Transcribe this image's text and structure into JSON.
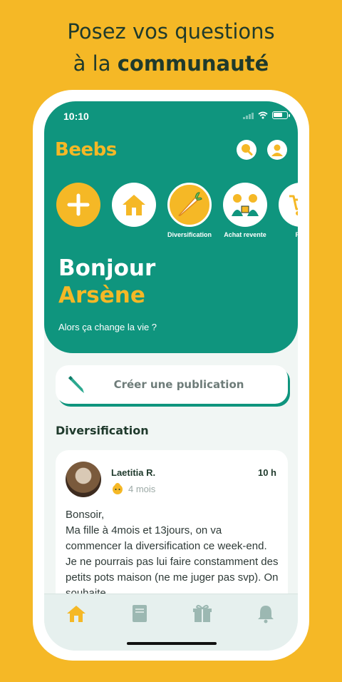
{
  "headline": {
    "line1": "Posez vos questions",
    "line2_prefix": "à la ",
    "line2_bold": "communauté"
  },
  "status_bar": {
    "time": "10:10"
  },
  "app": {
    "logo": "Beebs"
  },
  "header": {
    "search_icon": "search-icon",
    "profile_icon": "profile-icon"
  },
  "categories": [
    {
      "label": "",
      "icon": "plus-icon"
    },
    {
      "label": "",
      "icon": "home-icon"
    },
    {
      "label": "Diversification",
      "icon": "carrot-icon"
    },
    {
      "label": "Achat revente",
      "icon": "exchange-icon"
    },
    {
      "label": "Pro",
      "icon": "cart-icon"
    }
  ],
  "greeting": {
    "hello": "Bonjour",
    "name": "Arsène",
    "subtitle": "Alors ça change la vie ?"
  },
  "create_post": {
    "label": "Créer une publication"
  },
  "section_title": "Diversification",
  "post": {
    "author": "Laetitia  R.",
    "child_age": "4 mois",
    "time": "10 h",
    "body": "Bonsoir,\nMa fille à 4mois et 13jours, on va commencer la diversification ce week-end. Je ne pourrais pas lui faire constamment des petits pots maison (ne me juger pas svp). On souhaite"
  },
  "tabs": [
    {
      "name": "home",
      "icon": "home-icon",
      "active": true
    },
    {
      "name": "guide",
      "icon": "book-icon",
      "active": false
    },
    {
      "name": "gifts",
      "icon": "gift-icon",
      "active": false
    },
    {
      "name": "notifications",
      "icon": "bell-icon",
      "active": false
    }
  ],
  "colors": {
    "background": "#F5B826",
    "primary": "#0F957E",
    "accent": "#F5B826",
    "text_dark": "#1F3A2C"
  }
}
